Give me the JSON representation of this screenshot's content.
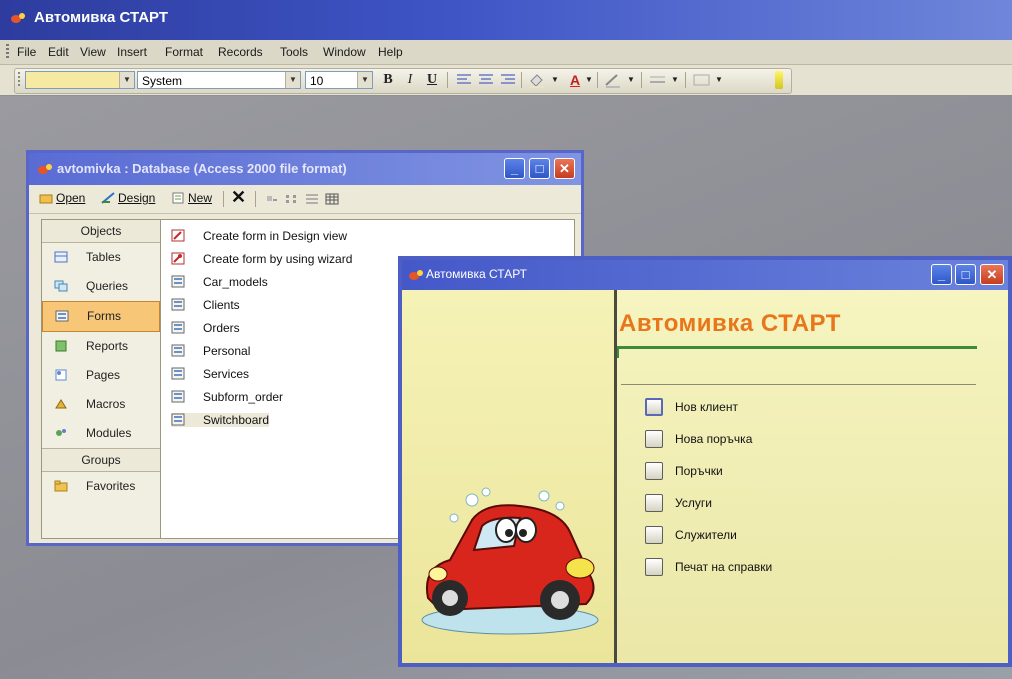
{
  "app": {
    "title": "Автомивка СТАРТ"
  },
  "menu": [
    "File",
    "Edit",
    "View",
    "Insert",
    "Format",
    "Records",
    "Tools",
    "Window",
    "Help"
  ],
  "toolbar": {
    "object_combo_value": "",
    "font_combo_value": "System",
    "size_combo_value": "10",
    "bold_label": "B",
    "italic_label": "I",
    "underline_label": "U",
    "font_color_label": "A"
  },
  "db_window": {
    "title": "avtomivka : Database (Access 2000 file format)",
    "toolbar": {
      "open_label": "Open",
      "design_label": "Design",
      "new_label": "New",
      "delete_glyph": "✕"
    },
    "objects_header": "Objects",
    "objects": [
      {
        "label": "Tables",
        "icon": "table-icon",
        "selected": false
      },
      {
        "label": "Queries",
        "icon": "query-icon",
        "selected": false
      },
      {
        "label": "Forms",
        "icon": "form-icon",
        "selected": true
      },
      {
        "label": "Reports",
        "icon": "report-icon",
        "selected": false
      },
      {
        "label": "Pages",
        "icon": "page-icon",
        "selected": false
      },
      {
        "label": "Macros",
        "icon": "macro-icon",
        "selected": false
      },
      {
        "label": "Modules",
        "icon": "module-icon",
        "selected": false
      }
    ],
    "groups_header": "Groups",
    "groups": [
      {
        "label": "Favorites",
        "icon": "favorites-folder-icon"
      }
    ],
    "items": [
      {
        "label": "Create form in Design view",
        "icon": "create-form-design-icon"
      },
      {
        "label": "Create form by using wizard",
        "icon": "create-form-wizard-icon"
      },
      {
        "label": "Car_models",
        "icon": "form-icon"
      },
      {
        "label": "Clients",
        "icon": "form-icon"
      },
      {
        "label": "Orders",
        "icon": "form-icon"
      },
      {
        "label": "Personal",
        "icon": "form-icon"
      },
      {
        "label": "Services",
        "icon": "form-icon"
      },
      {
        "label": "Subform_order",
        "icon": "form-icon"
      },
      {
        "label": "Switchboard",
        "icon": "form-icon",
        "highlighted": true
      }
    ]
  },
  "switchboard": {
    "window_title": "Автомивка СТАРТ",
    "banner_title": "Автомивка СТАРТ",
    "options": [
      {
        "label": "Нов клиент",
        "active": true
      },
      {
        "label": "Нова поръчка",
        "active": false
      },
      {
        "label": "Поръчки",
        "active": false
      },
      {
        "label": "Услуги",
        "active": false
      },
      {
        "label": "Служители",
        "active": false
      },
      {
        "label": "Печат на справки",
        "active": false
      }
    ]
  },
  "colors": {
    "banner_text": "#e8761b",
    "title_bar": "#3f55c6",
    "switchboard_bg": "#f3f0b4",
    "selected_object": "#f7c777"
  }
}
